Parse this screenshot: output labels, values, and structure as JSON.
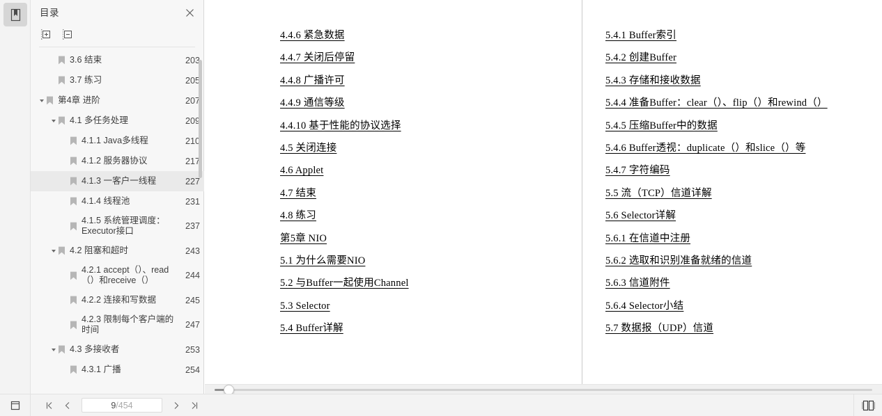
{
  "rail": {
    "bookmark_button": "bookmark-panel",
    "bottom_button": "page-layout"
  },
  "sidebar": {
    "title": "目录",
    "close_label": "×",
    "tools": [
      {
        "name": "expand-all",
        "label": "+"
      },
      {
        "name": "collapse-all",
        "label": "−"
      }
    ],
    "items": [
      {
        "label": "3.6 结束",
        "page": "203",
        "indent": 1,
        "twisty": "none",
        "selected": false
      },
      {
        "label": "3.7 练习",
        "page": "205",
        "indent": 1,
        "twisty": "none",
        "selected": false
      },
      {
        "label": "第4章 进阶",
        "page": "207",
        "indent": 0,
        "twisty": "open",
        "selected": false
      },
      {
        "label": "4.1 多任务处理",
        "page": "209",
        "indent": 1,
        "twisty": "open",
        "selected": false
      },
      {
        "label": "4.1.1 Java多线程",
        "page": "210",
        "indent": 2,
        "twisty": "none",
        "selected": false
      },
      {
        "label": "4.1.2 服务器协议",
        "page": "217",
        "indent": 2,
        "twisty": "none",
        "selected": false
      },
      {
        "label": "4.1.3 一客户一线程",
        "page": "227",
        "indent": 2,
        "twisty": "none",
        "selected": true
      },
      {
        "label": "4.1.4 线程池",
        "page": "231",
        "indent": 2,
        "twisty": "none",
        "selected": false
      },
      {
        "label": "4.1.5 系统管理调度：Executor接口",
        "page": "237",
        "indent": 2,
        "twisty": "none",
        "selected": false
      },
      {
        "label": "4.2 阻塞和超时",
        "page": "243",
        "indent": 1,
        "twisty": "open",
        "selected": false
      },
      {
        "label": "4.2.1 accept（）、read（）和receive（）",
        "page": "244",
        "indent": 2,
        "twisty": "none",
        "selected": false
      },
      {
        "label": "4.2.2 连接和写数据",
        "page": "245",
        "indent": 2,
        "twisty": "none",
        "selected": false
      },
      {
        "label": "4.2.3 限制每个客户端的时间",
        "page": "247",
        "indent": 2,
        "twisty": "none",
        "selected": false
      },
      {
        "label": "4.3 多接收者",
        "page": "253",
        "indent": 1,
        "twisty": "open",
        "selected": false
      },
      {
        "label": "4.3.1 广播",
        "page": "254",
        "indent": 2,
        "twisty": "none",
        "selected": false
      }
    ]
  },
  "document": {
    "left_page_entries": [
      "4.4.6  紧急数据",
      "4.4.7  关闭后停留",
      "4.4.8  广播许可",
      "4.4.9  通信等级",
      "4.4.10  基于性能的协议选择",
      "4.5  关闭连接",
      "4.6  Applet",
      "4.7  结束",
      "4.8  练习",
      "第5章  NIO",
      "5.1  为什么需要NIO",
      "5.2  与Buffer一起使用Channel",
      "5.3  Selector",
      "5.4  Buffer详解"
    ],
    "right_page_entries": [
      "5.4.1  Buffer索引",
      "5.4.2  创建Buffer",
      "5.4.3  存储和接收数据",
      "5.4.4  准备Buffer：clear（）、flip（）和rewind（）",
      "5.4.5  压缩Buffer中的数据",
      "5.4.6  Buffer透视：duplicate（）和slice（）等",
      "5.4.7  字符编码",
      "5.5  流（TCP）信道详解",
      "5.6  Selector详解",
      "5.6.1  在信道中注册",
      "5.6.2  选取和识别准备就绪的信道",
      "5.6.3  信道附件",
      "5.6.4  Selector小结",
      "5.7  数据报（UDP）信道"
    ]
  },
  "bottombar": {
    "first_page_label": "|<",
    "prev_page_label": "<",
    "current_page": "9",
    "total_pages": "/454",
    "next_page_label": ">",
    "last_page_label": ">|",
    "view_mode_icon": "book-view-icon",
    "panel_icon": "page-panel-icon"
  },
  "colors": {
    "sidebar_bg": "#f7f7f7",
    "rail_bg": "#f3f3f3",
    "selection": "#eaeaea",
    "page_bg": "#ffffff",
    "toolbar_bg": "#f3f3f3"
  }
}
